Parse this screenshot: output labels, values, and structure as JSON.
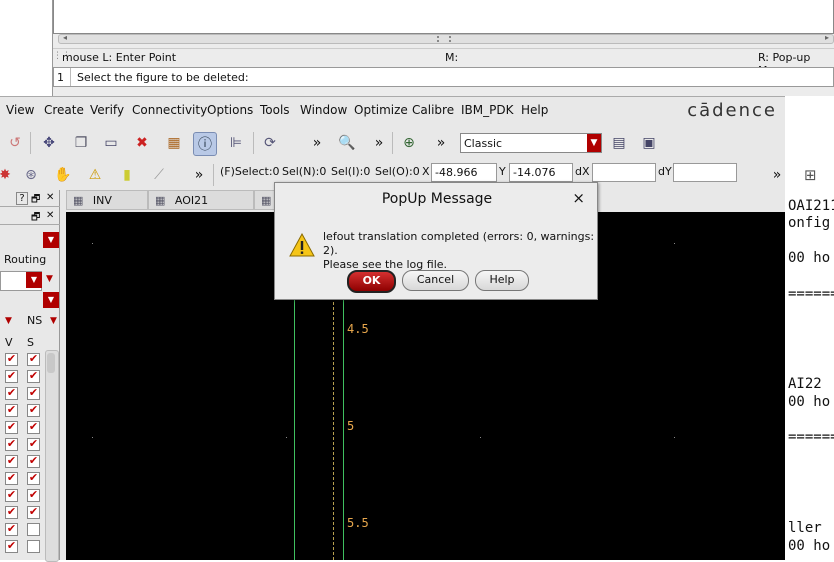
{
  "log_window": {
    "status_left": "mouse L: Enter Point",
    "status_mid": "M:",
    "status_right": "R: Pop-up Men",
    "cmd_number": "1",
    "cmd_prompt": "Select the figure to be deleted:"
  },
  "menubar": {
    "items": [
      "View",
      "Create",
      "Verify",
      "Connectivity",
      "Options",
      "Tools",
      "Window",
      "Optimize",
      "Calibre",
      "IBM_PDK",
      "Help"
    ],
    "brand": "cādence"
  },
  "toolbar": {
    "view_mode": "Classic",
    "more_glyph": "»"
  },
  "selection_bar": {
    "fselect": "(F)Select:0",
    "seln": "Sel(N):0",
    "seli": "Sel(I):0",
    "selo": "Sel(O):0",
    "x_label": "X",
    "x_value": "-48.966",
    "y_label": "Y",
    "y_value": "-14.076",
    "dx_label": "dX",
    "dx_value": "",
    "dy_label": "dY",
    "dy_value": ""
  },
  "left_panel": {
    "help_glyph": "?",
    "routing_label": "Routing",
    "ns_label": "NS",
    "col_v": "V",
    "col_s": "S",
    "rows_v": [
      true,
      true,
      true,
      true,
      true,
      true,
      true,
      true,
      true,
      true,
      true,
      true
    ],
    "rows_s": [
      true,
      true,
      true,
      true,
      true,
      true,
      true,
      true,
      true,
      true,
      false,
      false
    ]
  },
  "tabs": [
    {
      "label": "INV"
    },
    {
      "label": "AOI21"
    }
  ],
  "canvas": {
    "axis_labels": [
      "4.5",
      "5",
      "5.5"
    ]
  },
  "right_text": {
    "lines": [
      "OAI211",
      "onfig",
      "00 ho",
      "======",
      "AI22",
      "00 ho",
      "======",
      "ller",
      "00 ho"
    ]
  },
  "popup": {
    "title": "PopUp Message",
    "close_glyph": "×",
    "message_line1": "lefout translation completed (errors: 0, warnings: 2).",
    "message_line2": "Please see the log file.",
    "ok_label": "OK",
    "cancel_label": "Cancel",
    "help_label": "Help"
  },
  "colors": {
    "accent_red": "#b00000",
    "canvas_bg": "#000000",
    "axis_label": "#e6a64c",
    "track_green": "#3fbf5f"
  }
}
